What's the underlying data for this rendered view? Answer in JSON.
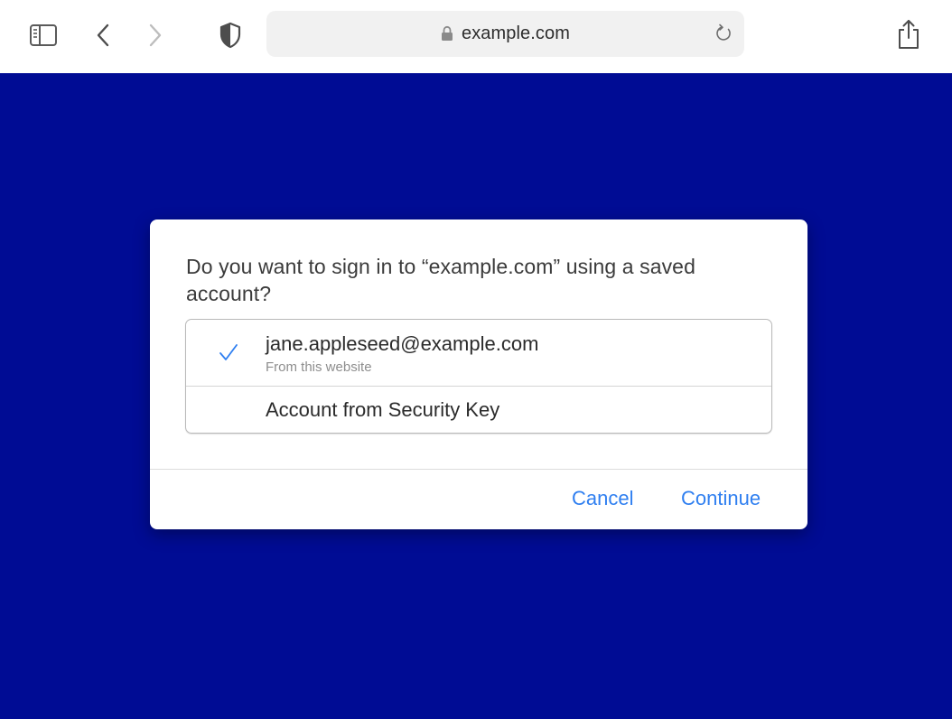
{
  "browser": {
    "url": "example.com",
    "icons": {
      "sidebar": "sidebar-icon",
      "back": "chevron-left-icon",
      "forward": "chevron-right-icon",
      "privacy": "shield-icon",
      "lock": "lock-icon",
      "reload": "reload-icon",
      "share": "share-icon"
    }
  },
  "page": {
    "background_color": "#000c94"
  },
  "dialog": {
    "title": "Do you want to sign in to “example.com” using a saved account?",
    "accounts": [
      {
        "name": "jane.appleseed@example.com",
        "subtitle": "From this website",
        "selected": true
      },
      {
        "name": "Account from Security Key",
        "selected": false
      }
    ],
    "cancel_label": "Cancel",
    "continue_label": "Continue",
    "accent_color": "#2f7ff0"
  }
}
